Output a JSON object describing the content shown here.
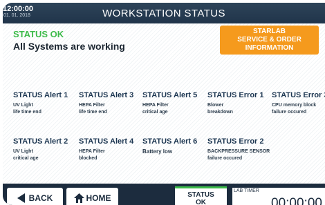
{
  "header": {
    "time": "12:00:00",
    "date": "01. 01. 2018",
    "title": "WORKSTATION STATUS"
  },
  "status": {
    "label": "STATUS OK",
    "message": "All Systems are working"
  },
  "starlab_button": {
    "line1": "STARLAB",
    "line2": "SERVICE & ORDER",
    "line3": "INFORMATION"
  },
  "alerts": [
    {
      "title": "STATUS Alert 1",
      "line1": "UV Light",
      "line2": "life time end"
    },
    {
      "title": "STATUS Alert 3",
      "line1": "HEPA Filter",
      "line2": "life time end"
    },
    {
      "title": "STATUS Alert 5",
      "line1": "HEPA Filter",
      "line2": "critical age"
    },
    {
      "title": "STATUS Error 1",
      "line1": "Blower",
      "line2": "breakdown"
    },
    {
      "title": "STATUS Error 3",
      "line1": "CPU memory block",
      "line2": "failure occured"
    },
    {
      "title": "STATUS Alert 2",
      "line1": "UV Light",
      "line2": "critical age"
    },
    {
      "title": "STATUS Alert 4",
      "line1": "HEPA Filter",
      "line2": "blocked"
    },
    {
      "title": "STATUS Alert 6",
      "line1": "Battery low"
    },
    {
      "title": "STATUS Error 2",
      "line1": "BACKPRESSURE SENSOR",
      "line2": "failure occured"
    }
  ],
  "footer": {
    "back_label": "BACK",
    "home_label": "HOME",
    "status_tab_line1": "STATUS",
    "status_tab_line2": "OK",
    "timer_label": "LAB TIMER",
    "timer_value": "00:00:00"
  },
  "colors": {
    "ok_green": "#3dbb4a",
    "accent_orange": "#f59a1d",
    "navy": "#1c2c3e"
  }
}
